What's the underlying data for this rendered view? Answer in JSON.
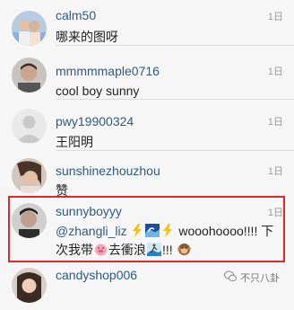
{
  "comments": [
    {
      "username": "calm50",
      "text": "哪来的图呀",
      "time": "1日",
      "avatar": "photo-couple"
    },
    {
      "username": "mmmmmaple0716",
      "text": "cool boy sunny",
      "time": "1日",
      "avatar": "photo-man"
    },
    {
      "username": "pwy19900324",
      "text": "王阳明",
      "time": "1日",
      "avatar": "default-avatar"
    },
    {
      "username": "sunshinezhouzhou",
      "text": "赞",
      "time": "1日",
      "avatar": "photo-woman"
    },
    {
      "username": "sunnyboyyy",
      "mention": "@zhangli_liz",
      "text_after_emojis": "wooohoooo!!!! 下",
      "text_line2_a": "次我带",
      "text_line2_b": "去衝浪",
      "text_line2_c": "!!!",
      "time": "1日",
      "avatar": "photo-boy"
    },
    {
      "username": "candyshop006",
      "time": "",
      "avatar": "photo-girl"
    }
  ],
  "emojis": [
    "lightning-emoji",
    "wave-emoji",
    "lightning-emoji",
    "pig-emoji",
    "surfer-emoji",
    "monkey-emoji"
  ],
  "highlight_color": "#e02a2a",
  "username_color": "#2d5a86",
  "watermark": {
    "text": "不只八卦",
    "icon": "wechat-icon"
  }
}
